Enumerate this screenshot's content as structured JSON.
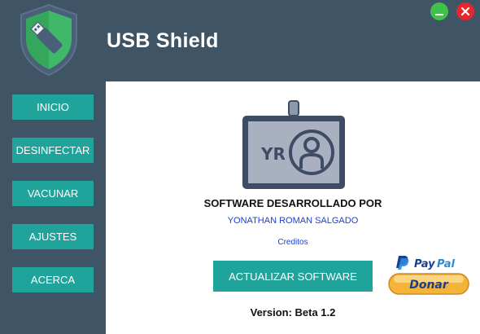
{
  "app": {
    "title": "USB Shield",
    "colors": {
      "sidebar": "#3f5465",
      "accent": "#1fa39a",
      "minimize": "#3ec24a",
      "close": "#e5262e",
      "link": "#1a3fd6"
    },
    "icons": {
      "logo": "usb-shield-icon",
      "minimize": "minimize-icon",
      "close": "close-icon",
      "badge": "id-badge-icon"
    }
  },
  "sidebar": {
    "items": [
      {
        "label": "INICIO"
      },
      {
        "label": "DESINFECTAR"
      },
      {
        "label": "VACUNAR"
      },
      {
        "label": "AJUSTES"
      },
      {
        "label": "ACERCA"
      }
    ]
  },
  "about": {
    "badge_initials": "YR",
    "heading": "SOFTWARE DESARROLLADO POR",
    "developer": "YONATHAN ROMAN SALGADO",
    "credits_link": "Creditos",
    "update_button": "ACTUALIZAR SOFTWARE",
    "paypal_brand_1": "Pay",
    "paypal_brand_2": "Pal",
    "donate_button": "Donar",
    "version": "Version: Beta 1.2"
  }
}
